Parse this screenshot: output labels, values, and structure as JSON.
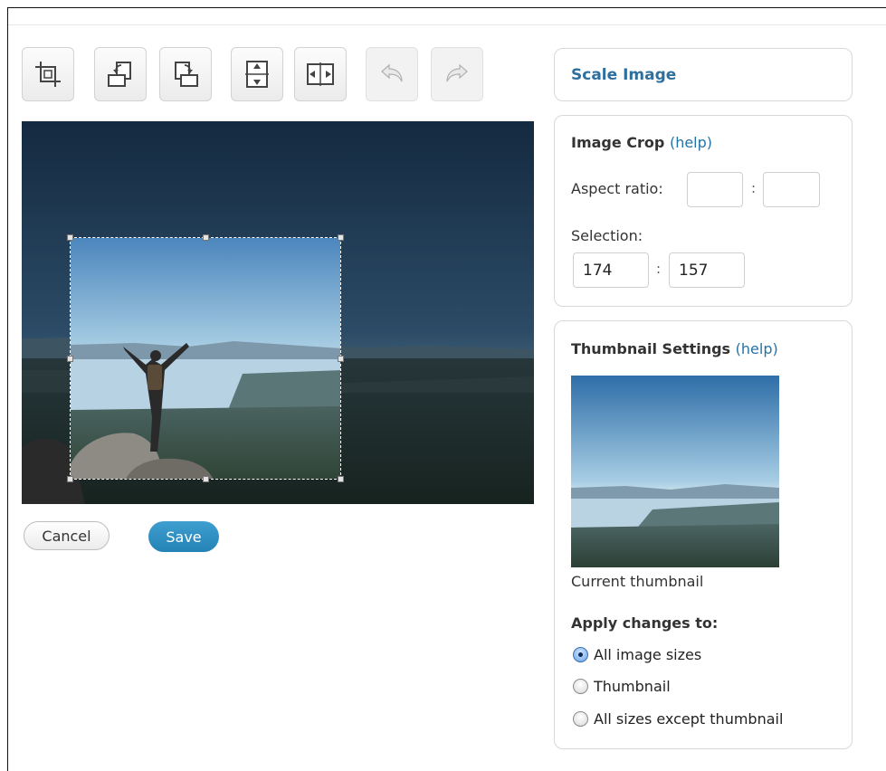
{
  "toolbar": {
    "buttons": [
      {
        "icon": "crop-icon",
        "enabled": true
      },
      {
        "icon": "rotate-left-icon",
        "enabled": true
      },
      {
        "icon": "rotate-right-icon",
        "enabled": true
      },
      {
        "icon": "flip-vertical-icon",
        "enabled": true
      },
      {
        "icon": "flip-horizontal-icon",
        "enabled": true
      },
      {
        "icon": "undo-icon",
        "enabled": false
      },
      {
        "icon": "redo-icon",
        "enabled": false
      }
    ]
  },
  "actions": {
    "cancel_label": "Cancel",
    "save_label": "Save"
  },
  "scale_panel": {
    "title": "Scale Image"
  },
  "crop_panel": {
    "title": "Image Crop",
    "help_label": "(help)",
    "aspect_label": "Aspect ratio:",
    "aspect_width": "",
    "aspect_height": "",
    "selection_label": "Selection:",
    "selection_width": "174",
    "selection_height": "157",
    "separator": ":"
  },
  "thumbnail_panel": {
    "title": "Thumbnail Settings",
    "help_label": "(help)",
    "caption": "Current thumbnail",
    "apply_label": "Apply changes to:",
    "options": [
      {
        "label": "All image sizes",
        "checked": true
      },
      {
        "label": "Thumbnail",
        "checked": false
      },
      {
        "label": "All sizes except thumbnail",
        "checked": false
      }
    ]
  },
  "colors": {
    "link": "#2473a5",
    "save_button": "#2a8ac0"
  }
}
